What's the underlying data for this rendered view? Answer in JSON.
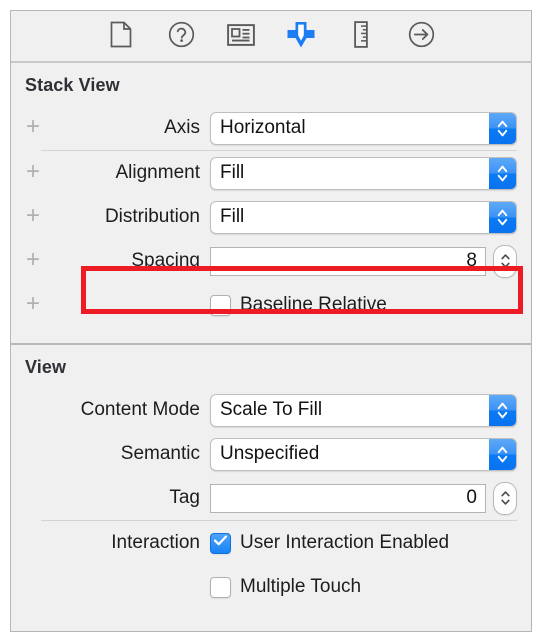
{
  "toolbar": {
    "buttons": [
      {
        "name": "file-inspector",
        "icon": "document-icon",
        "selected": false
      },
      {
        "name": "quick-help-inspector",
        "icon": "question-circle-icon",
        "selected": false
      },
      {
        "name": "identity-inspector",
        "icon": "identity-card-icon",
        "selected": false
      },
      {
        "name": "attributes-inspector",
        "icon": "attributes-arrow-icon",
        "selected": true
      },
      {
        "name": "size-inspector",
        "icon": "ruler-icon",
        "selected": false
      },
      {
        "name": "connections-inspector",
        "icon": "arrow-right-circle-icon",
        "selected": false
      }
    ],
    "selected_color": "#1d7df5"
  },
  "sections": {
    "stack_view": {
      "title": "Stack View",
      "axis": {
        "label": "Axis",
        "value": "Horizontal",
        "plus": "+"
      },
      "alignment": {
        "label": "Alignment",
        "value": "Fill",
        "plus": "+"
      },
      "distribution": {
        "label": "Distribution",
        "value": "Fill",
        "plus": "+"
      },
      "spacing": {
        "label": "Spacing",
        "value": "8",
        "plus": "+"
      },
      "baseline_relative": {
        "label": "Baseline Relative",
        "checked": false,
        "plus": "+"
      }
    },
    "view": {
      "title": "View",
      "content_mode": {
        "label": "Content Mode",
        "value": "Scale To Fill"
      },
      "semantic": {
        "label": "Semantic",
        "value": "Unspecified"
      },
      "tag": {
        "label": "Tag",
        "value": "0"
      },
      "interaction": {
        "label": "Interaction",
        "user_interaction_enabled": {
          "label": "User Interaction Enabled",
          "checked": true
        },
        "multiple_touch": {
          "label": "Multiple Touch",
          "checked": false
        }
      }
    }
  },
  "annotation": {
    "color": "#ed1c24",
    "target": "spacing-row"
  }
}
